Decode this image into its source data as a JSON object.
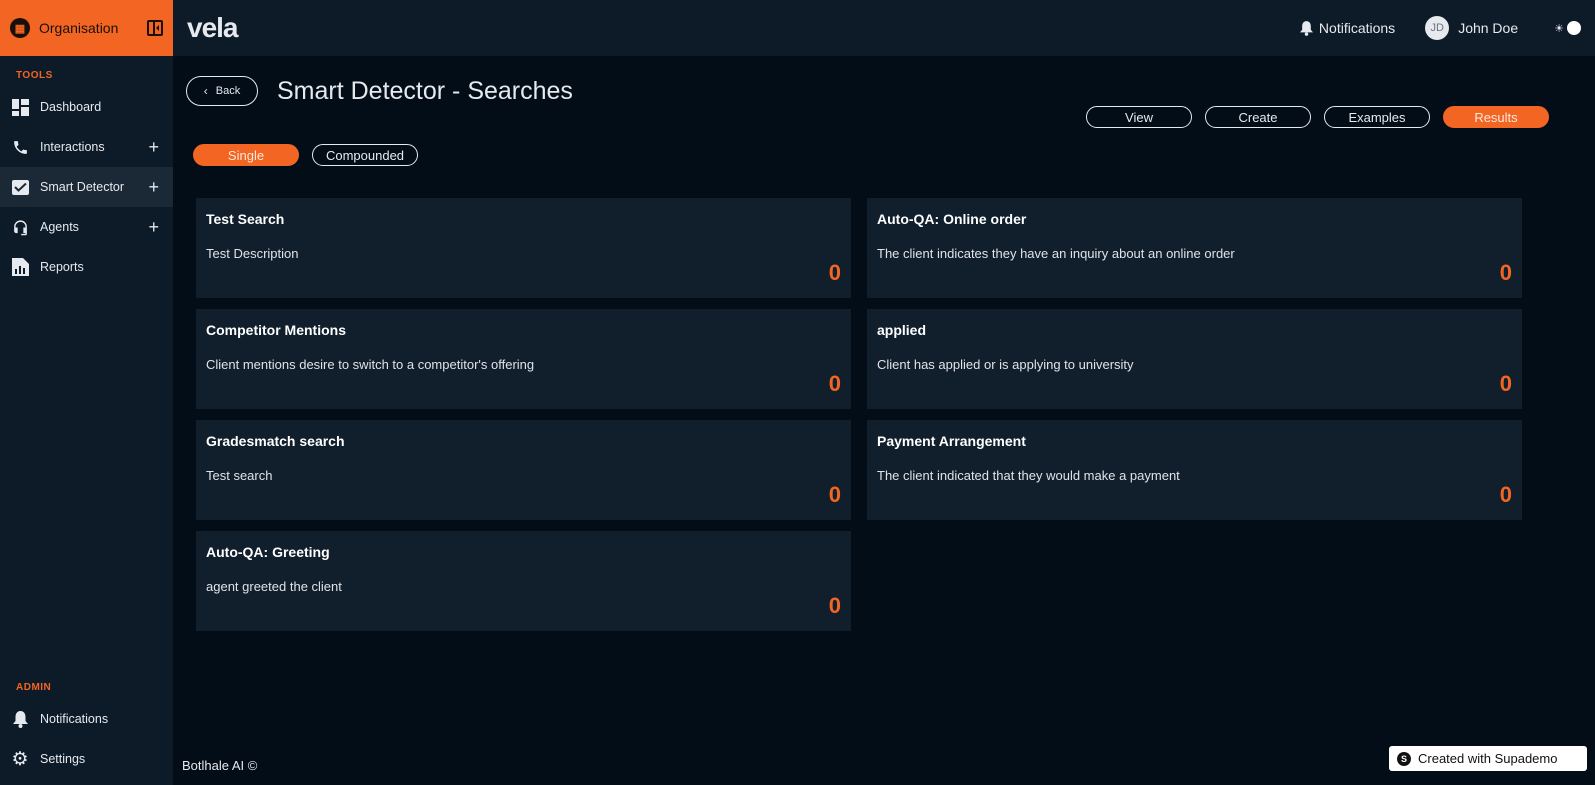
{
  "sidebar": {
    "org_label": "Organisation",
    "tools_title": "TOOLS",
    "tools": [
      {
        "label": "Dashboard",
        "icon": "dashboard-icon",
        "expandable": false
      },
      {
        "label": "Interactions",
        "icon": "phone-icon",
        "expandable": true
      },
      {
        "label": "Smart Detector",
        "icon": "smart-detector-icon",
        "expandable": true
      },
      {
        "label": "Agents",
        "icon": "headset-icon",
        "expandable": true
      },
      {
        "label": "Reports",
        "icon": "report-icon",
        "expandable": false
      }
    ],
    "admin_title": "ADMIN",
    "admin": [
      {
        "label": "Notifications",
        "icon": "bell-icon"
      },
      {
        "label": "Settings",
        "icon": "gear-icon"
      }
    ]
  },
  "header": {
    "logo_text": "vela",
    "notifications_label": "Notifications",
    "user_initials": "JD",
    "user_name": "John Doe"
  },
  "page": {
    "back_label": "Back",
    "title": "Smart Detector - Searches",
    "view_tabs": [
      {
        "label": "View",
        "active": false
      },
      {
        "label": "Create",
        "active": false
      },
      {
        "label": "Examples",
        "active": false
      },
      {
        "label": "Results",
        "active": true
      }
    ],
    "mode_tabs": [
      {
        "label": "Single",
        "active": true
      },
      {
        "label": "Compounded",
        "active": false
      }
    ],
    "searches": [
      {
        "title": "Test Search",
        "description": "Test Description",
        "count": "0"
      },
      {
        "title": "Auto-QA: Online order",
        "description": "The client indicates they have an inquiry about an online order",
        "count": "0"
      },
      {
        "title": "Competitor Mentions",
        "description": "Client mentions desire to switch to a competitor's offering",
        "count": "0"
      },
      {
        "title": "applied",
        "description": "Client has applied or is applying to university",
        "count": "0"
      },
      {
        "title": "Gradesmatch search",
        "description": "Test search",
        "count": "0"
      },
      {
        "title": "Payment Arrangement",
        "description": "The client indicated that they would make a payment",
        "count": "0"
      },
      {
        "title": "Auto-QA: Greeting",
        "description": "agent greeted the client",
        "count": "0"
      }
    ]
  },
  "footer": {
    "copyright": "Botlhale AI ©",
    "supademo_label": "Created with Supademo"
  },
  "colors": {
    "accent": "#f26522",
    "background": "#020d17",
    "panel": "#0d1b28",
    "card": "#111e2c"
  }
}
